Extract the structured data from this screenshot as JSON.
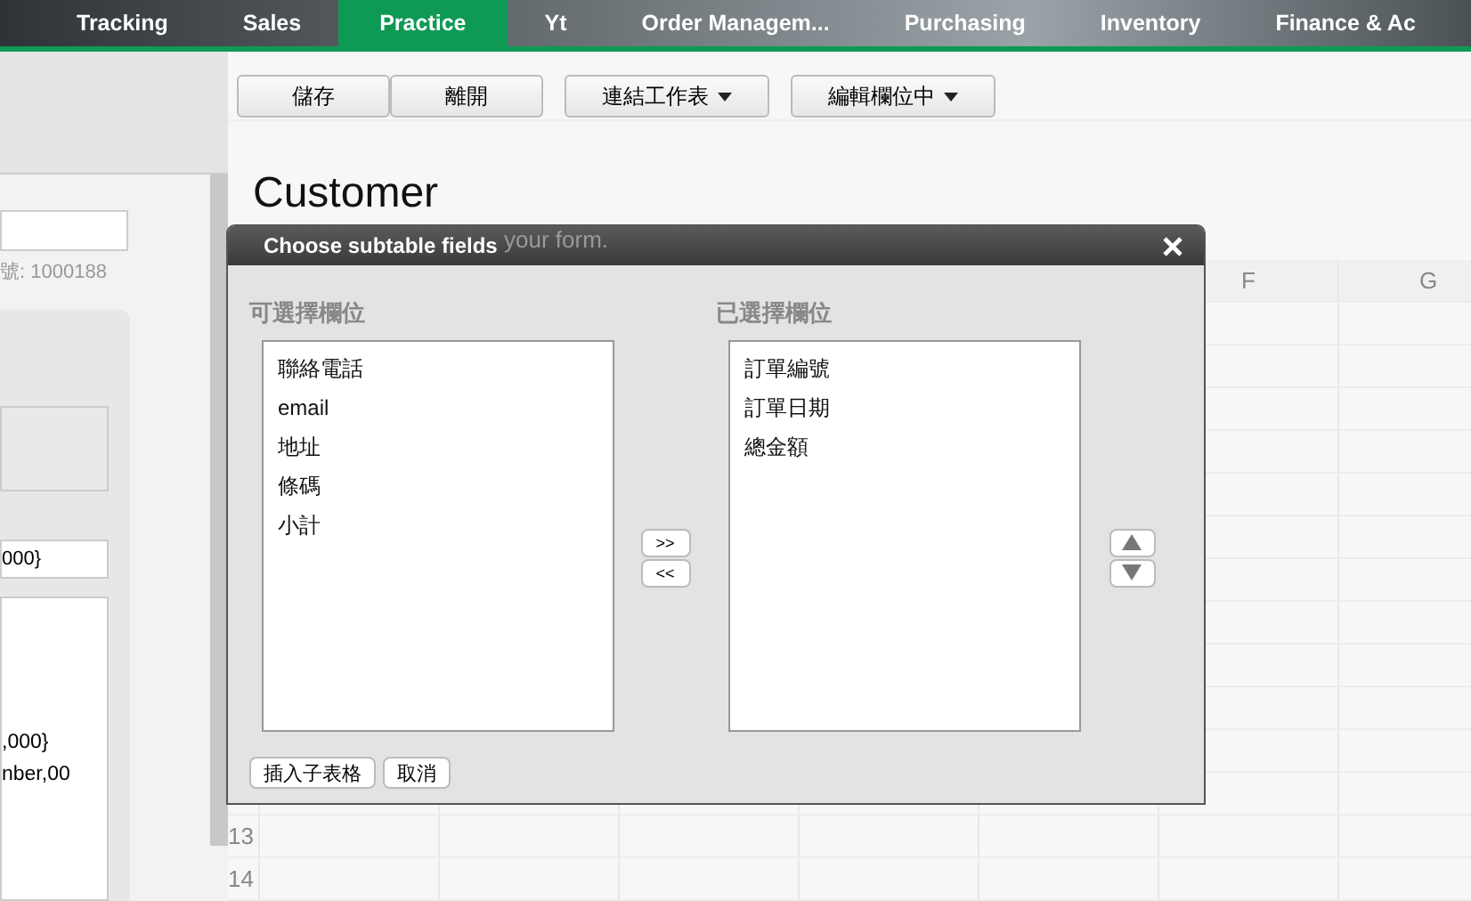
{
  "nav": {
    "tabs": [
      {
        "label": "Tracking",
        "selected": false
      },
      {
        "label": "Sales",
        "selected": false
      },
      {
        "label": "Practice",
        "selected": true
      },
      {
        "label": "Yt",
        "selected": false
      },
      {
        "label": "Order Managem...",
        "selected": false
      },
      {
        "label": "Purchasing",
        "selected": false
      },
      {
        "label": "Inventory",
        "selected": false
      },
      {
        "label": "Finance & Ac",
        "selected": false
      }
    ]
  },
  "sidebar": {
    "record_number": "號: 1000188",
    "formula_field": "000}",
    "formula_lines": [
      ",000}",
      "nber,00"
    ]
  },
  "toolbar": {
    "buttons": [
      {
        "label": "儲存",
        "dropdown": false
      },
      {
        "label": "離開",
        "dropdown": false
      },
      {
        "label": "連結工作表",
        "dropdown": true
      },
      {
        "label": "編輯欄位中",
        "dropdown": true
      }
    ]
  },
  "form": {
    "title": "Customer",
    "description": "your form."
  },
  "sheet": {
    "columns": [
      "F",
      "G"
    ],
    "row_numbers": [
      "13",
      "14"
    ]
  },
  "dialog": {
    "title": "Choose subtable fields",
    "available_label": "可選擇欄位",
    "available": [
      "聯絡電話",
      "email",
      "地址",
      "條碼",
      "小計"
    ],
    "selected_label": "已選擇欄位",
    "selected_fields": [
      "訂單編號",
      "訂單日期",
      "總金額"
    ],
    "add_button": ">>",
    "remove_button": "<<",
    "footer_buttons": [
      "插入子表格",
      "取消"
    ]
  }
}
